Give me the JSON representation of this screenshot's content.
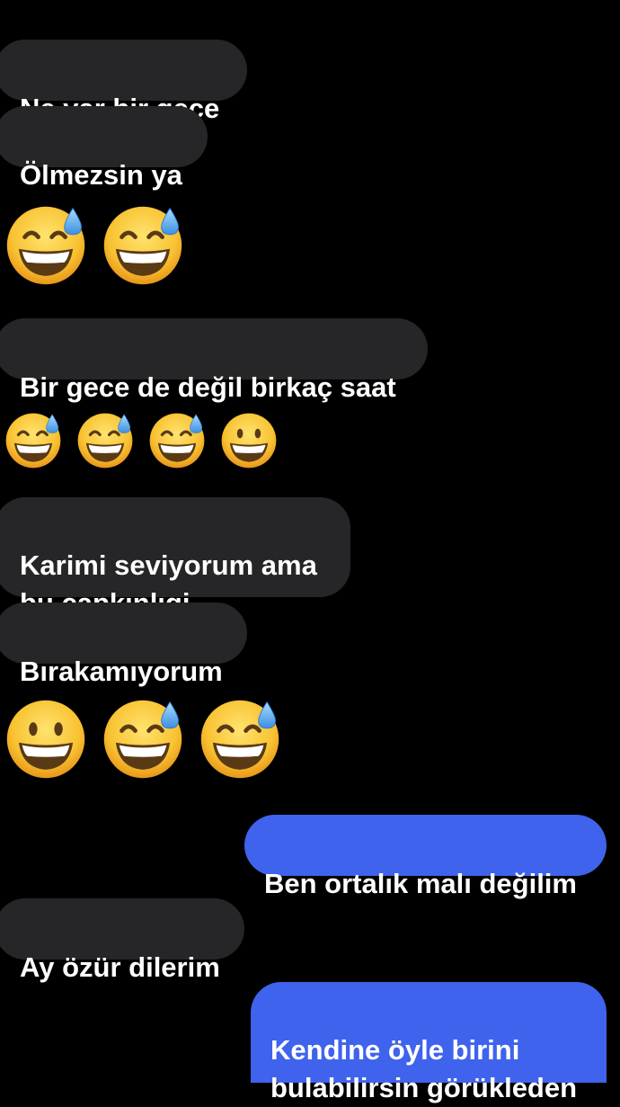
{
  "messages": [
    {
      "id": "m1",
      "direction": "incoming",
      "text": "Ne var bir gece"
    },
    {
      "id": "m2",
      "direction": "incoming",
      "text": "Ölmezsin ya"
    },
    {
      "id": "e1",
      "type": "emoji",
      "emojis": [
        "grinning-face-with-sweat",
        "grinning-face-with-sweat"
      ]
    },
    {
      "id": "m3",
      "direction": "incoming",
      "text": "Bir gece de değil birkaç saat"
    },
    {
      "id": "e2",
      "type": "emoji",
      "emojis": [
        "grinning-face-with-sweat",
        "grinning-face-with-sweat",
        "grinning-face-with-sweat",
        "grinning-face"
      ]
    },
    {
      "id": "m4",
      "direction": "incoming",
      "text": "Karimi seviyorum ama\nbu çapkınlıgi"
    },
    {
      "id": "m5",
      "direction": "incoming",
      "text": "Bırakamıyorum"
    },
    {
      "id": "e3",
      "type": "emoji",
      "emojis": [
        "grinning-face",
        "grinning-face-with-sweat",
        "grinning-face-with-sweat"
      ]
    },
    {
      "id": "m6",
      "direction": "outgoing",
      "text": "Ben ortalık malı değilim"
    },
    {
      "id": "m7",
      "direction": "incoming",
      "text": "Ay özür dilerim"
    },
    {
      "id": "m8",
      "direction": "outgoing",
      "text": "Kendine öyle birini\nbulabilirsin görükleden"
    }
  ],
  "colors": {
    "background": "#000000",
    "incoming_bubble": "#262628",
    "outgoing_bubble": "#3f63ec",
    "text": "#ffffff",
    "emoji_face": "#f7c33a",
    "sweat_drop": "#5aa9f0"
  }
}
